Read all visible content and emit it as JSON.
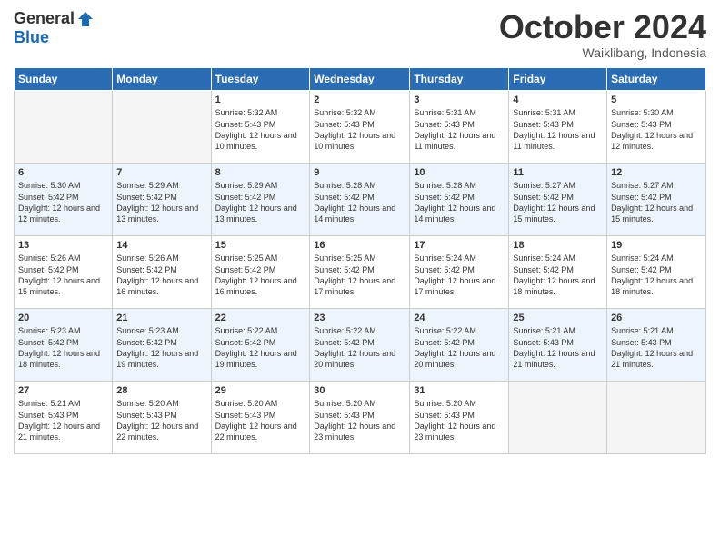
{
  "logo": {
    "general": "General",
    "blue": "Blue"
  },
  "title": "October 2024",
  "location": "Waiklibang, Indonesia",
  "weekdays": [
    "Sunday",
    "Monday",
    "Tuesday",
    "Wednesday",
    "Thursday",
    "Friday",
    "Saturday"
  ],
  "weeks": [
    [
      {
        "day": "",
        "sunrise": "",
        "sunset": "",
        "daylight": "",
        "empty": true
      },
      {
        "day": "",
        "sunrise": "",
        "sunset": "",
        "daylight": "",
        "empty": true
      },
      {
        "day": "1",
        "sunrise": "Sunrise: 5:32 AM",
        "sunset": "Sunset: 5:43 PM",
        "daylight": "Daylight: 12 hours and 10 minutes."
      },
      {
        "day": "2",
        "sunrise": "Sunrise: 5:32 AM",
        "sunset": "Sunset: 5:43 PM",
        "daylight": "Daylight: 12 hours and 10 minutes."
      },
      {
        "day": "3",
        "sunrise": "Sunrise: 5:31 AM",
        "sunset": "Sunset: 5:43 PM",
        "daylight": "Daylight: 12 hours and 11 minutes."
      },
      {
        "day": "4",
        "sunrise": "Sunrise: 5:31 AM",
        "sunset": "Sunset: 5:43 PM",
        "daylight": "Daylight: 12 hours and 11 minutes."
      },
      {
        "day": "5",
        "sunrise": "Sunrise: 5:30 AM",
        "sunset": "Sunset: 5:43 PM",
        "daylight": "Daylight: 12 hours and 12 minutes."
      }
    ],
    [
      {
        "day": "6",
        "sunrise": "Sunrise: 5:30 AM",
        "sunset": "Sunset: 5:42 PM",
        "daylight": "Daylight: 12 hours and 12 minutes."
      },
      {
        "day": "7",
        "sunrise": "Sunrise: 5:29 AM",
        "sunset": "Sunset: 5:42 PM",
        "daylight": "Daylight: 12 hours and 13 minutes."
      },
      {
        "day": "8",
        "sunrise": "Sunrise: 5:29 AM",
        "sunset": "Sunset: 5:42 PM",
        "daylight": "Daylight: 12 hours and 13 minutes."
      },
      {
        "day": "9",
        "sunrise": "Sunrise: 5:28 AM",
        "sunset": "Sunset: 5:42 PM",
        "daylight": "Daylight: 12 hours and 14 minutes."
      },
      {
        "day": "10",
        "sunrise": "Sunrise: 5:28 AM",
        "sunset": "Sunset: 5:42 PM",
        "daylight": "Daylight: 12 hours and 14 minutes."
      },
      {
        "day": "11",
        "sunrise": "Sunrise: 5:27 AM",
        "sunset": "Sunset: 5:42 PM",
        "daylight": "Daylight: 12 hours and 15 minutes."
      },
      {
        "day": "12",
        "sunrise": "Sunrise: 5:27 AM",
        "sunset": "Sunset: 5:42 PM",
        "daylight": "Daylight: 12 hours and 15 minutes."
      }
    ],
    [
      {
        "day": "13",
        "sunrise": "Sunrise: 5:26 AM",
        "sunset": "Sunset: 5:42 PM",
        "daylight": "Daylight: 12 hours and 15 minutes."
      },
      {
        "day": "14",
        "sunrise": "Sunrise: 5:26 AM",
        "sunset": "Sunset: 5:42 PM",
        "daylight": "Daylight: 12 hours and 16 minutes."
      },
      {
        "day": "15",
        "sunrise": "Sunrise: 5:25 AM",
        "sunset": "Sunset: 5:42 PM",
        "daylight": "Daylight: 12 hours and 16 minutes."
      },
      {
        "day": "16",
        "sunrise": "Sunrise: 5:25 AM",
        "sunset": "Sunset: 5:42 PM",
        "daylight": "Daylight: 12 hours and 17 minutes."
      },
      {
        "day": "17",
        "sunrise": "Sunrise: 5:24 AM",
        "sunset": "Sunset: 5:42 PM",
        "daylight": "Daylight: 12 hours and 17 minutes."
      },
      {
        "day": "18",
        "sunrise": "Sunrise: 5:24 AM",
        "sunset": "Sunset: 5:42 PM",
        "daylight": "Daylight: 12 hours and 18 minutes."
      },
      {
        "day": "19",
        "sunrise": "Sunrise: 5:24 AM",
        "sunset": "Sunset: 5:42 PM",
        "daylight": "Daylight: 12 hours and 18 minutes."
      }
    ],
    [
      {
        "day": "20",
        "sunrise": "Sunrise: 5:23 AM",
        "sunset": "Sunset: 5:42 PM",
        "daylight": "Daylight: 12 hours and 18 minutes."
      },
      {
        "day": "21",
        "sunrise": "Sunrise: 5:23 AM",
        "sunset": "Sunset: 5:42 PM",
        "daylight": "Daylight: 12 hours and 19 minutes."
      },
      {
        "day": "22",
        "sunrise": "Sunrise: 5:22 AM",
        "sunset": "Sunset: 5:42 PM",
        "daylight": "Daylight: 12 hours and 19 minutes."
      },
      {
        "day": "23",
        "sunrise": "Sunrise: 5:22 AM",
        "sunset": "Sunset: 5:42 PM",
        "daylight": "Daylight: 12 hours and 20 minutes."
      },
      {
        "day": "24",
        "sunrise": "Sunrise: 5:22 AM",
        "sunset": "Sunset: 5:42 PM",
        "daylight": "Daylight: 12 hours and 20 minutes."
      },
      {
        "day": "25",
        "sunrise": "Sunrise: 5:21 AM",
        "sunset": "Sunset: 5:43 PM",
        "daylight": "Daylight: 12 hours and 21 minutes."
      },
      {
        "day": "26",
        "sunrise": "Sunrise: 5:21 AM",
        "sunset": "Sunset: 5:43 PM",
        "daylight": "Daylight: 12 hours and 21 minutes."
      }
    ],
    [
      {
        "day": "27",
        "sunrise": "Sunrise: 5:21 AM",
        "sunset": "Sunset: 5:43 PM",
        "daylight": "Daylight: 12 hours and 21 minutes."
      },
      {
        "day": "28",
        "sunrise": "Sunrise: 5:20 AM",
        "sunset": "Sunset: 5:43 PM",
        "daylight": "Daylight: 12 hours and 22 minutes."
      },
      {
        "day": "29",
        "sunrise": "Sunrise: 5:20 AM",
        "sunset": "Sunset: 5:43 PM",
        "daylight": "Daylight: 12 hours and 22 minutes."
      },
      {
        "day": "30",
        "sunrise": "Sunrise: 5:20 AM",
        "sunset": "Sunset: 5:43 PM",
        "daylight": "Daylight: 12 hours and 23 minutes."
      },
      {
        "day": "31",
        "sunrise": "Sunrise: 5:20 AM",
        "sunset": "Sunset: 5:43 PM",
        "daylight": "Daylight: 12 hours and 23 minutes."
      },
      {
        "day": "",
        "sunrise": "",
        "sunset": "",
        "daylight": "",
        "empty": true
      },
      {
        "day": "",
        "sunrise": "",
        "sunset": "",
        "daylight": "",
        "empty": true
      }
    ]
  ]
}
